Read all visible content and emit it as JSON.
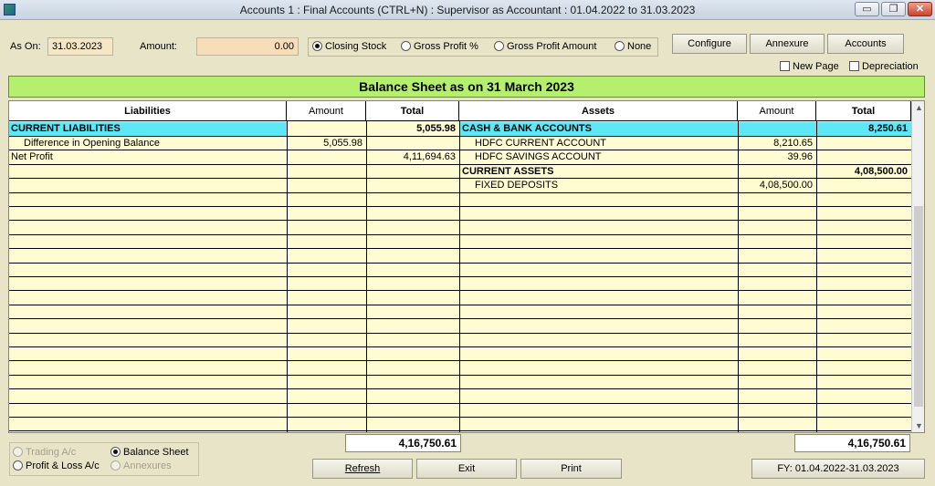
{
  "window": {
    "title": "Accounts 1 : Final Accounts (CTRL+N) : Supervisor as Accountant : 01.04.2022 to 31.03.2023",
    "min_label": "▭",
    "restore_label": "❐",
    "close_label": "✕"
  },
  "toolbar": {
    "as_on_label": "As On:",
    "as_on_value": "31.03.2023",
    "amount_label": "Amount:",
    "amount_value": "0.00",
    "options": [
      {
        "label": "Closing Stock",
        "selected": true
      },
      {
        "label": "Gross Profit %",
        "selected": false
      },
      {
        "label": "Gross Profit Amount",
        "selected": false
      },
      {
        "label": "None",
        "selected": false
      }
    ],
    "configure_label": "Configure",
    "annexure_label": "Annexure",
    "accounts_label": "Accounts",
    "new_page_label": "New Page",
    "depreciation_label": "Depreciation"
  },
  "report": {
    "title": "Balance Sheet as on 31 March 2023",
    "headers": {
      "liabilities": "Liabilities",
      "amount": "Amount",
      "total": "Total",
      "assets": "Assets",
      "amount2": "Amount",
      "total2": "Total"
    },
    "rows": [
      {
        "l_name": "CURRENT LIABILITIES",
        "l_amt": "",
        "l_tot": "5,055.98",
        "a_name": "CASH & BANK ACCOUNTS",
        "a_amt": "",
        "a_tot": "8,250.61"
      },
      {
        "l_name": "Difference in Opening Balance",
        "l_amt": "5,055.98",
        "l_tot": "",
        "a_name": "HDFC CURRENT ACCOUNT",
        "a_amt": "8,210.65",
        "a_tot": ""
      },
      {
        "l_name": "Net Profit",
        "l_amt": "",
        "l_tot": "4,11,694.63",
        "a_name": "HDFC SAVINGS ACCOUNT",
        "a_amt": "39.96",
        "a_tot": ""
      },
      {
        "l_name": "",
        "l_amt": "",
        "l_tot": "",
        "a_name": "CURRENT ASSETS",
        "a_amt": "",
        "a_tot": "4,08,500.00"
      },
      {
        "l_name": "",
        "l_amt": "",
        "l_tot": "",
        "a_name": "FIXED DEPOSITS",
        "a_amt": "4,08,500.00",
        "a_tot": ""
      }
    ],
    "liabilities_total": "4,16,750.61",
    "assets_total": "4,16,750.61"
  },
  "views": {
    "trading": "Trading A/c",
    "balance_sheet": "Balance Sheet",
    "profit_loss": "Profit & Loss A/c",
    "annexures": "Annexures"
  },
  "actions": {
    "refresh_label": "Refresh",
    "exit_label": "Exit",
    "print_label": "Print",
    "fy_label": "FY: 01.04.2022-31.03.2023"
  },
  "colors": {
    "banner": "#b4f06e",
    "grid_bg": "#fffbd2",
    "highlight_row": "#5ee7f7",
    "window_bg": "#e8e4c8"
  }
}
